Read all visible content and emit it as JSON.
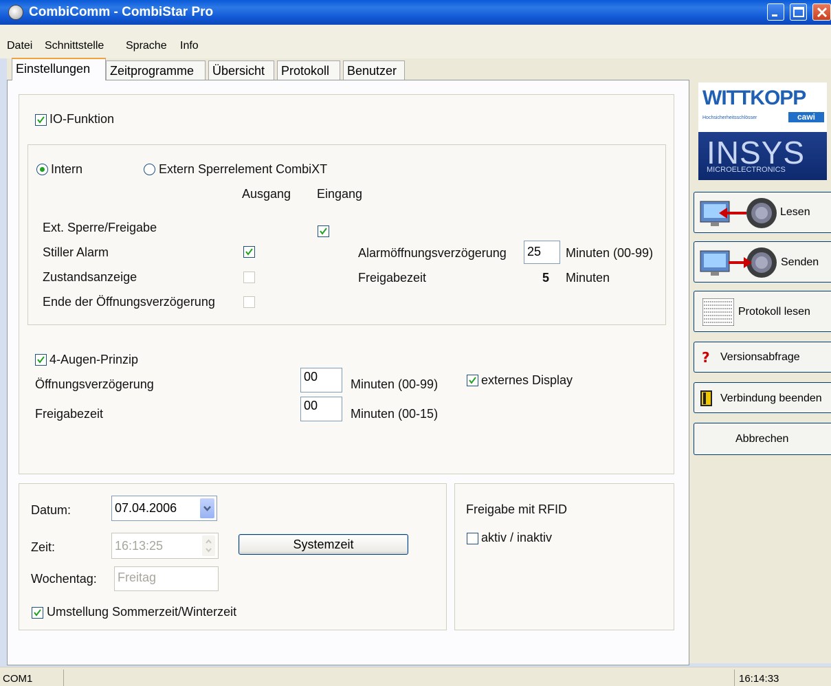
{
  "window": {
    "title": "CombiComm - CombiStar Pro"
  },
  "menu": [
    "Datei",
    "Schnittstelle",
    "Sprache",
    "Info"
  ],
  "tabs": [
    "Einstellungen",
    "Zeitprogramme",
    "Übersicht",
    "Protokoll",
    "Benutzer"
  ],
  "io": {
    "checkbox_label": "IO-Funktion",
    "intern_label": "Intern",
    "extern_label": "Extern Sperrelement CombiXT",
    "col_ausgang": "Ausgang",
    "col_eingang": "Eingang",
    "rows": [
      {
        "label": "Ext. Sperre/Freigabe",
        "ausgang": null,
        "eingang": true
      },
      {
        "label": "Stiller Alarm",
        "ausgang": true,
        "eingang": null
      },
      {
        "label": "Zustandsanzeige",
        "ausgang": false,
        "eingang": null
      },
      {
        "label": "Ende der Öffnungsverzögerung",
        "ausgang": false,
        "eingang": null
      }
    ],
    "alarm_label": "Alarmöffnungsverzögerung",
    "alarm_value": "25",
    "alarm_unit": "Minuten (00-99)",
    "freigabe_label": "Freigabezeit",
    "freigabe_value": "5",
    "freigabe_unit": "Minuten"
  },
  "augen": {
    "checkbox_label": "4-Augen-Prinzip",
    "oeffnung_label": "Öffnungsverzögerung",
    "oeffnung_value": "00",
    "oeffnung_unit": "Minuten (00-99)",
    "freigabe_label": "Freigabezeit",
    "freigabe_value": "00",
    "freigabe_unit": "Minuten (00-15)",
    "display_label": "externes Display"
  },
  "datetime": {
    "datum_label": "Datum:",
    "datum_value": "07.04.2006",
    "zeit_label": "Zeit:",
    "zeit_value": "16:13:25",
    "systemzeit_button": "Systemzeit",
    "wochentag_label": "Wochentag:",
    "wochentag_value": "Freitag",
    "sommerzeit_label": "Umstellung Sommerzeit/Winterzeit"
  },
  "rfid": {
    "title": "Freigabe mit RFID",
    "checkbox_label": "aktiv / inaktiv"
  },
  "sidebar": {
    "logo_top": "WITTKOPP",
    "logo_sub": "Hochsicherheitsschlösser",
    "logo_badge": "cawi",
    "logo_bottom": "INSYS",
    "logo_bottom_sub": "MICROELECTRONICS",
    "buttons": [
      "Lesen",
      "Senden",
      "Protokoll lesen",
      "Versionsabfrage",
      "Verbindung beenden",
      "Abbrechen"
    ]
  },
  "statusbar": {
    "port": "COM1",
    "time": "16:14:33"
  },
  "colors": {
    "titlebar": "#0a5ad8",
    "check": "#21a121",
    "tab_highlight": "#f2a23a"
  }
}
